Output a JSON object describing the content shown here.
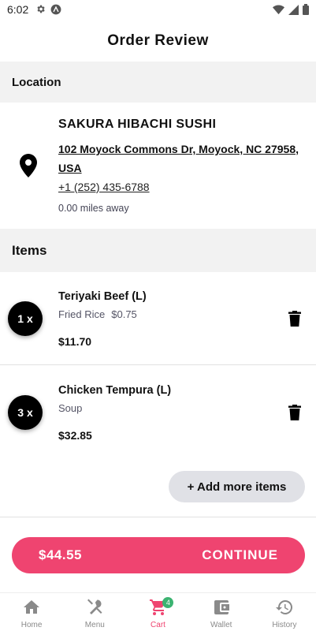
{
  "status_bar": {
    "time": "6:02"
  },
  "header": {
    "title": "Order Review"
  },
  "location": {
    "section_label": "Location",
    "name": "SAKURA HIBACHI SUSHI",
    "address": "102 Moyock Commons Dr, Moyock, NC 27958, USA",
    "phone": "+1 (252) 435-6788",
    "distance": "0.00 miles away"
  },
  "items": {
    "section_label": "Items",
    "list": [
      {
        "qty": "1 x",
        "name": "Teriyaki Beef (L)",
        "option": "Fried Rice",
        "option_price": "$0.75",
        "price": "$11.70"
      },
      {
        "qty": "3 x",
        "name": "Chicken Tempura (L)",
        "option": "Soup",
        "option_price": "",
        "price": "$32.85"
      }
    ]
  },
  "add_more_label": "+ Add more items",
  "checkout": {
    "total": "$44.55",
    "continue_label": "CONTINUE"
  },
  "nav": {
    "items": [
      {
        "label": "Home",
        "icon": "home-icon"
      },
      {
        "label": "Menu",
        "icon": "utensils-icon"
      },
      {
        "label": "Cart",
        "icon": "cart-icon",
        "badge": "4",
        "active": true
      },
      {
        "label": "Wallet",
        "icon": "wallet-icon"
      },
      {
        "label": "History",
        "icon": "history-icon"
      }
    ]
  },
  "colors": {
    "accent": "#ef4470",
    "badge_green": "#3cb371",
    "section_bg": "#f2f2f2"
  }
}
